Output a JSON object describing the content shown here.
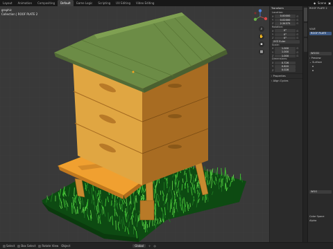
{
  "topbar": {
    "tabs": [
      {
        "label": "Layout",
        "active": false
      },
      {
        "label": "Animation",
        "active": false
      },
      {
        "label": "Compositing",
        "active": false
      },
      {
        "label": "Default",
        "active": true
      },
      {
        "label": "Game Logic",
        "active": false
      },
      {
        "label": "Scripting",
        "active": false
      },
      {
        "label": "UV Editing",
        "active": false
      },
      {
        "label": "Video Editing",
        "active": false
      }
    ],
    "scene_label": "Scene"
  },
  "viewport": {
    "mode_label": "graphic",
    "collection_path": "Collection | ROOF PLATE 2"
  },
  "npanel": {
    "header": "Transform",
    "location_label": "Location:",
    "location": [
      {
        "axis": "X",
        "value": "0.00000"
      },
      {
        "axis": "Y",
        "value": "0.02000"
      },
      {
        "axis": "Z",
        "value": "2.34375"
      }
    ],
    "rotation_label": "Rotation:",
    "rotation": [
      {
        "axis": "X",
        "value": "0°"
      },
      {
        "axis": "Y",
        "value": "0°"
      },
      {
        "axis": "Z",
        "value": "0°"
      }
    ],
    "rotation_mode": "XYZ Euler",
    "scale_label": "Scale:",
    "scale": [
      {
        "axis": "X",
        "value": "1.000"
      },
      {
        "axis": "Y",
        "value": "1.000"
      },
      {
        "axis": "Z",
        "value": "1.000"
      }
    ],
    "dimensions_label": "Dimensions:",
    "dimensions": [
      {
        "axis": "X",
        "value": "0.726"
      },
      {
        "axis": "Y",
        "value": "0.820"
      },
      {
        "axis": "Z",
        "value": "0.028"
      }
    ],
    "section_properties": "Properties",
    "section_align": "Align Cycles"
  },
  "properties": {
    "object_name": "ROOF PLATE 2",
    "mesh_name": "VLVE",
    "material_name": "ROOF PLATE",
    "material_field": "WOOD",
    "preview_label": "Preview",
    "surface_label": "Surface",
    "bottom_field": "WOO",
    "color_space_label": "Color Space",
    "alpha_label": "Alpha"
  },
  "statusbar": {
    "items": [
      "Select",
      "Box Select",
      "Rotate View",
      "Object"
    ],
    "global_label": "Global"
  },
  "colors": {
    "roof": "#6c8c46",
    "roof_dark": "#526b36",
    "wood_light": "#e0a642",
    "wood_mid": "#c98a30",
    "wood_dark": "#a86c22",
    "ramp": "#f0a030",
    "grass_base": "#0d4a12",
    "grass_light": "#4cd038",
    "viewport_bg": "#3a3a3a",
    "selection_outline": "#f5a623"
  }
}
